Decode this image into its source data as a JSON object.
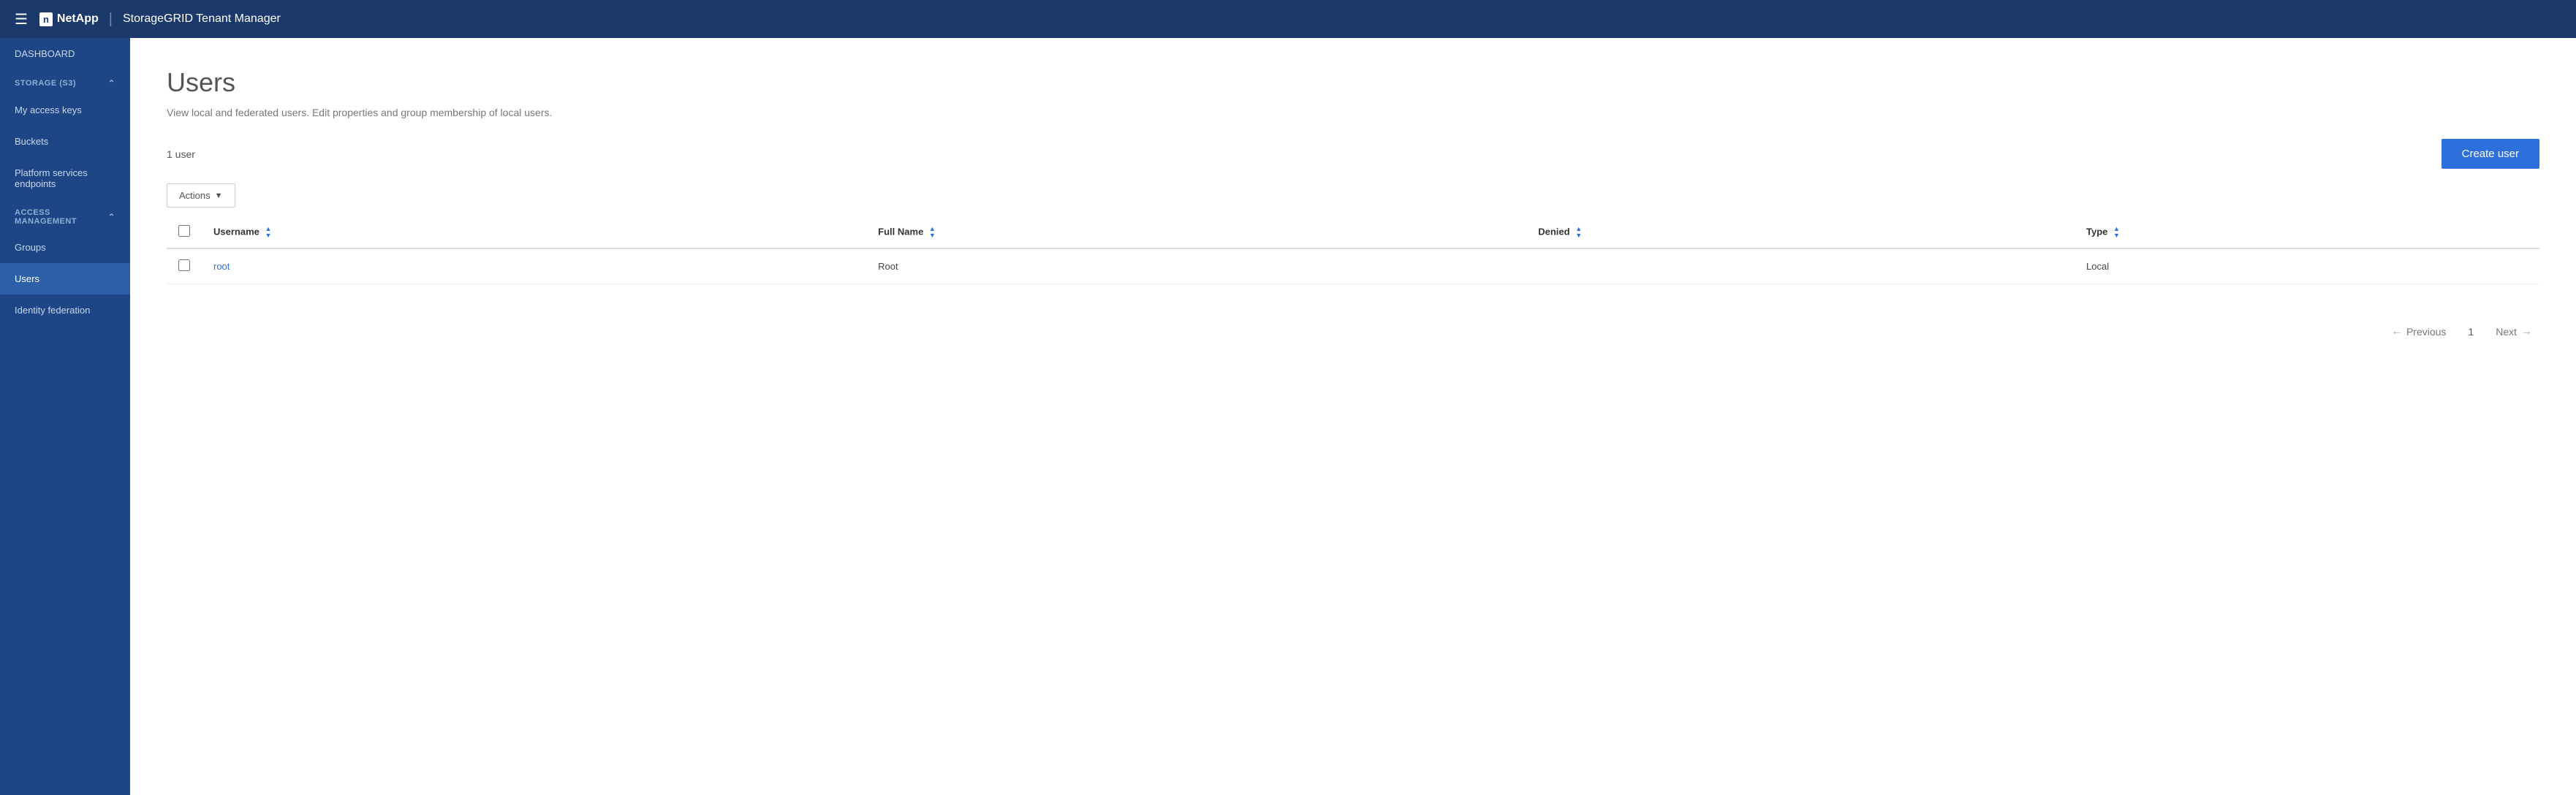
{
  "nav": {
    "hamburger": "☰",
    "logo_text": "n",
    "brand_name": "NetApp",
    "divider": "|",
    "app_title": "StorageGRID Tenant Manager"
  },
  "sidebar": {
    "dashboard_label": "DASHBOARD",
    "storage_section": "STORAGE (S3)",
    "storage_items": [
      {
        "id": "my-access-keys",
        "label": "My access keys"
      },
      {
        "id": "buckets",
        "label": "Buckets"
      },
      {
        "id": "platform-services-endpoints",
        "label": "Platform services endpoints"
      }
    ],
    "access_section": "ACCESS MANAGEMENT",
    "access_items": [
      {
        "id": "groups",
        "label": "Groups"
      },
      {
        "id": "users",
        "label": "Users"
      },
      {
        "id": "identity-federation",
        "label": "Identity federation"
      }
    ]
  },
  "main": {
    "page_title": "Users",
    "page_subtitle": "View local and federated users. Edit properties and group membership of local users.",
    "user_count": "1 user",
    "create_user_label": "Create user",
    "actions_label": "Actions",
    "table": {
      "columns": [
        {
          "id": "username",
          "label": "Username"
        },
        {
          "id": "full_name",
          "label": "Full Name"
        },
        {
          "id": "denied",
          "label": "Denied"
        },
        {
          "id": "type",
          "label": "Type"
        }
      ],
      "rows": [
        {
          "username": "root",
          "full_name": "Root",
          "denied": "",
          "type": "Local"
        }
      ]
    }
  },
  "pagination": {
    "previous_label": "Previous",
    "next_label": "Next",
    "current_page": "1"
  }
}
